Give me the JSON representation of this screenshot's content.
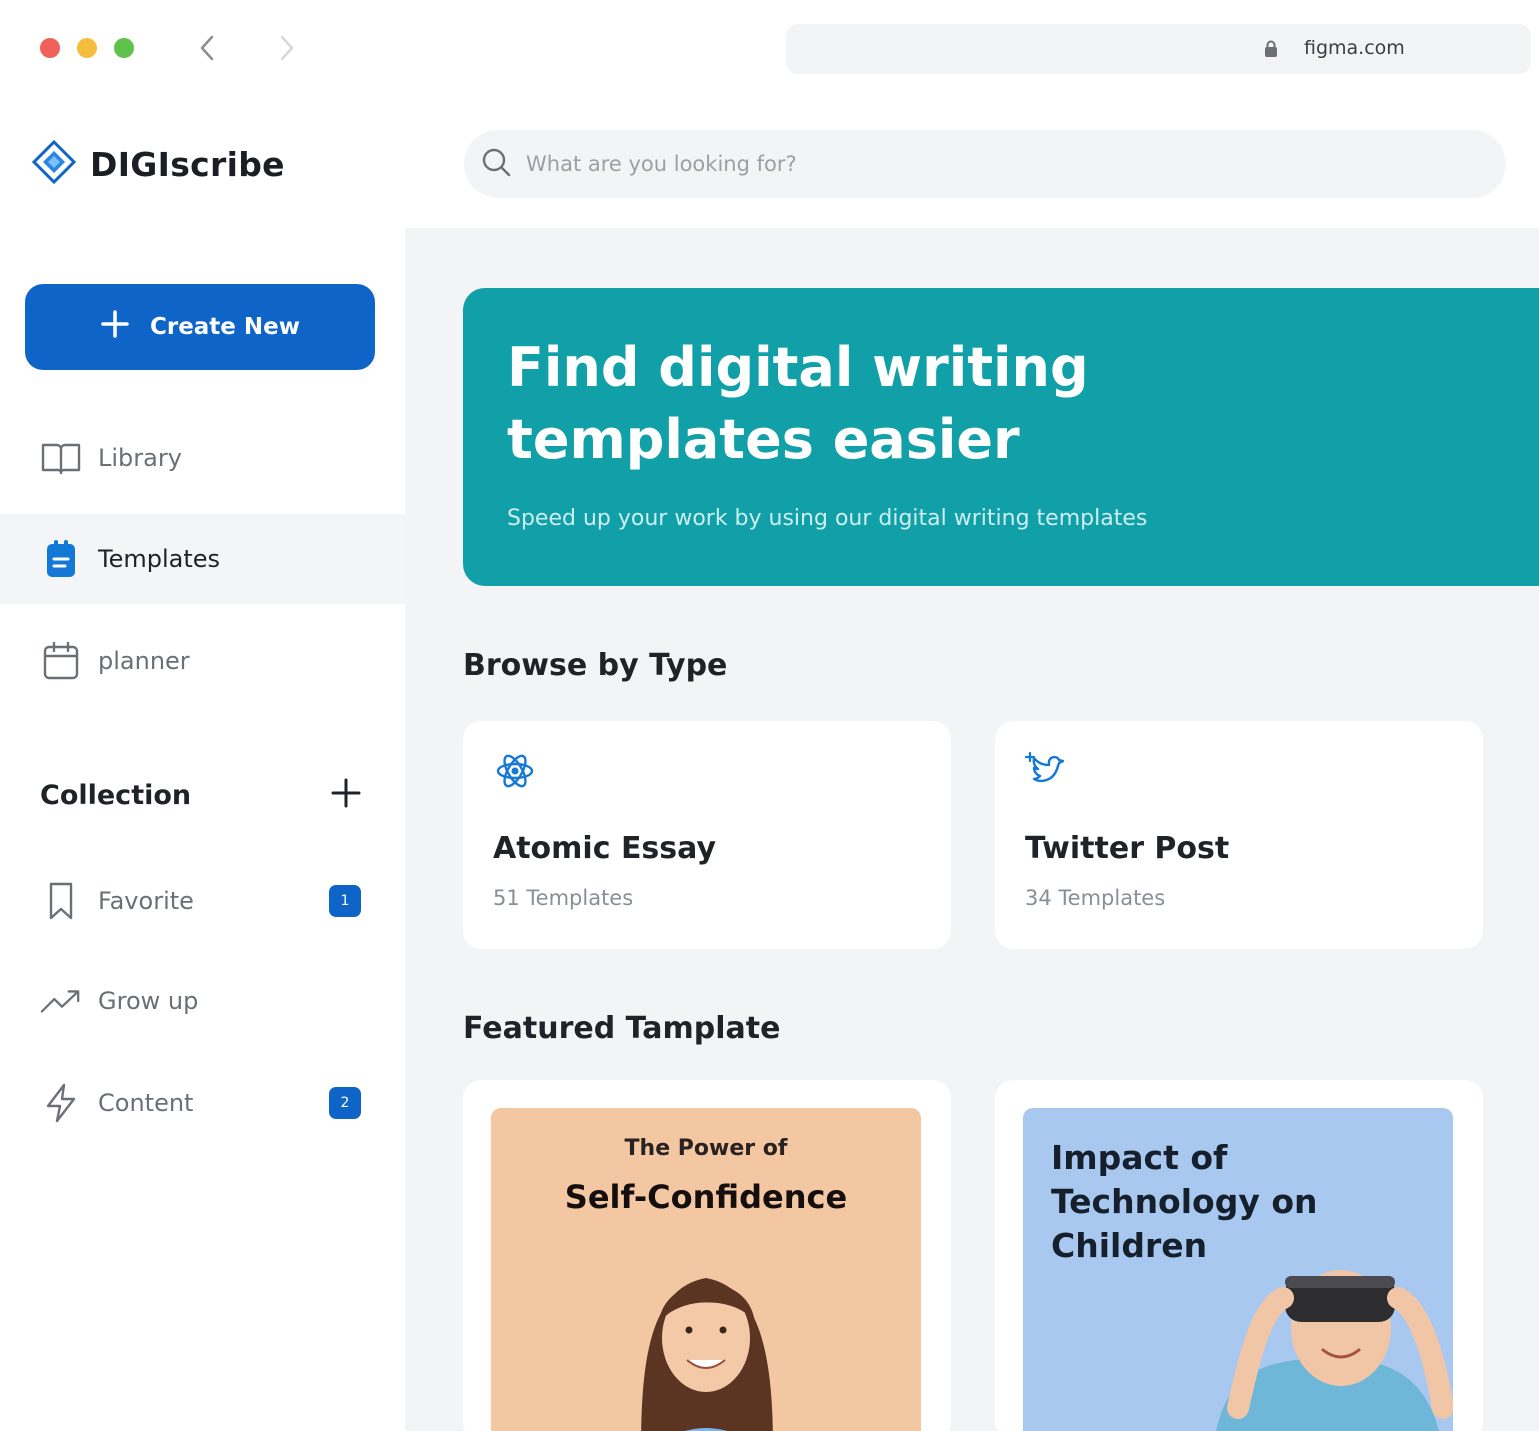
{
  "browser": {
    "url": "figma.com"
  },
  "brand": {
    "name": "DIGIscribe"
  },
  "sidebar": {
    "create_label": "Create New",
    "nav": [
      {
        "label": "Library",
        "icon": "book-icon"
      },
      {
        "label": "Templates",
        "icon": "template-icon",
        "active": true
      },
      {
        "label": "planner",
        "icon": "calendar-icon"
      }
    ],
    "collection": {
      "title": "Collection",
      "items": [
        {
          "label": "Favorite",
          "icon": "bookmark-icon",
          "badge": "1"
        },
        {
          "label": "Grow up",
          "icon": "trend-icon"
        },
        {
          "label": "Content",
          "icon": "lightning-icon",
          "badge": "2"
        }
      ]
    }
  },
  "search": {
    "placeholder": "What are you looking for?"
  },
  "hero": {
    "title": "Find digital writing templates easier",
    "subtitle": "Speed up your work by using our digital writing templates"
  },
  "browse": {
    "title": "Browse by Type",
    "types": [
      {
        "name": "Atomic Essay",
        "count": "51 Templates",
        "icon": "atom-icon"
      },
      {
        "name": "Twitter Post",
        "count": "34 Templates",
        "icon": "twitter-icon"
      }
    ]
  },
  "featured": {
    "title": "Featured Tamplate",
    "items": [
      {
        "kicker": "The Power of",
        "title": "Self-Confidence"
      },
      {
        "title": "Impact of Technology on Children"
      }
    ]
  },
  "colors": {
    "accent": "#0f64c8",
    "hero": "#12a0a8",
    "cover_peach": "#f2c7a2",
    "cover_blue": "#a9c8ef"
  }
}
